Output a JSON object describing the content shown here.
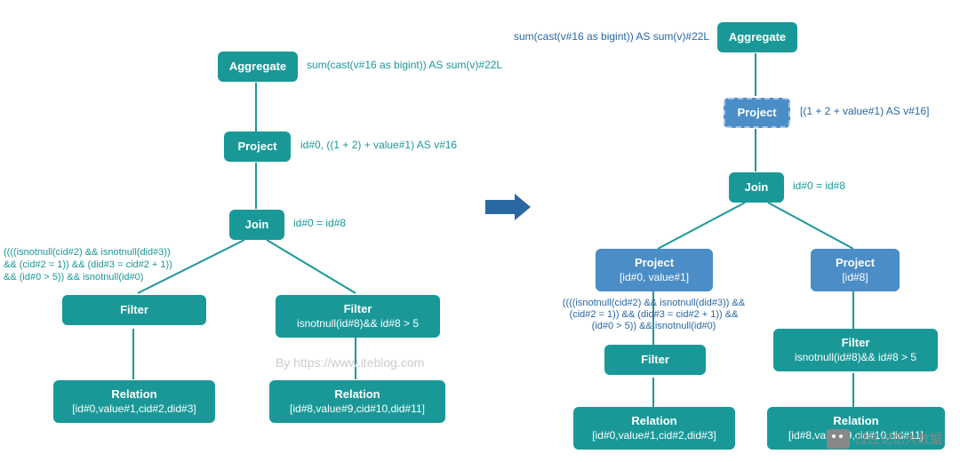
{
  "left": {
    "aggregate": {
      "label": "Aggregate",
      "annot": "sum(cast(v#16 as bigint)) AS sum(v)#22L"
    },
    "project": {
      "label": "Project",
      "annot": "id#0, ((1 + 2) + value#1) AS v#16"
    },
    "join": {
      "label": "Join",
      "annot": "id#0 = id#8"
    },
    "filterL": {
      "label": "Filter",
      "annot": "((((isnotnull(cid#2) && isnotnull(did#3))\n&& (cid#2 = 1)) && (did#3 = cid#2 + 1))\n&& (id#0 > 5)) && isnotnull(id#0)"
    },
    "filterR": {
      "label": "Filter",
      "sub": "isnotnull(id#8)&& id#8 > 5"
    },
    "relL": {
      "label": "Relation",
      "sub": "[id#0,value#1,cid#2,did#3]"
    },
    "relR": {
      "label": "Relation",
      "sub": "[id#8,value#9,cid#10,did#11]"
    }
  },
  "right": {
    "aggregate": {
      "label": "Aggregate",
      "annot": "sum(cast(v#16 as bigint)) AS sum(v)#22L"
    },
    "project": {
      "label": "Project",
      "annot": "[(1 + 2 + value#1) AS v#16]"
    },
    "join": {
      "label": "Join",
      "annot": "id#0 = id#8"
    },
    "projL": {
      "label": "Project",
      "sub": "[id#0, value#1]"
    },
    "projR": {
      "label": "Project",
      "sub": "[id#8]"
    },
    "filterL": {
      "label": "Filter",
      "annot": "((((isnotnull(cid#2) && isnotnull(did#3)) &&\n(cid#2 = 1)) && (did#3 = cid#2 + 1)) &&\n(id#0 > 5)) && isnotnull(id#0)"
    },
    "filterR": {
      "label": "Filter",
      "sub": "isnotnull(id#8)&& id#8 > 5"
    },
    "relL": {
      "label": "Relation",
      "sub": "[id#0,value#1,cid#2,did#3]"
    },
    "relR": {
      "label": "Relation",
      "sub": "[id#8,value#9,cid#10,did#11]"
    }
  },
  "watermark": "By https://www.iteblog.com",
  "footer": "过往记忆大数据"
}
